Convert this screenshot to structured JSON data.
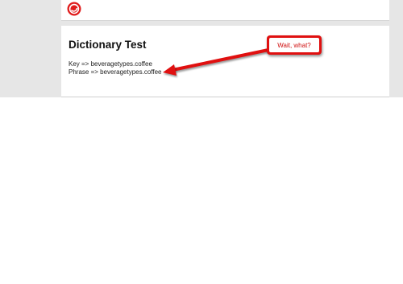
{
  "colors": {
    "background": "#e6e6e6",
    "panel": "#ffffff",
    "annotation_red": "#e01010"
  },
  "header": {
    "logo_icon": "red-circle-logo-icon"
  },
  "page": {
    "title": "Dictionary Test",
    "key_line": "Key => beveragetypes.coffee",
    "phrase_line": "Phrase => beveragetypes.coffee"
  },
  "annotation": {
    "callout_text": "Wait, what?",
    "arrow_icon": "red-arrow-icon"
  }
}
